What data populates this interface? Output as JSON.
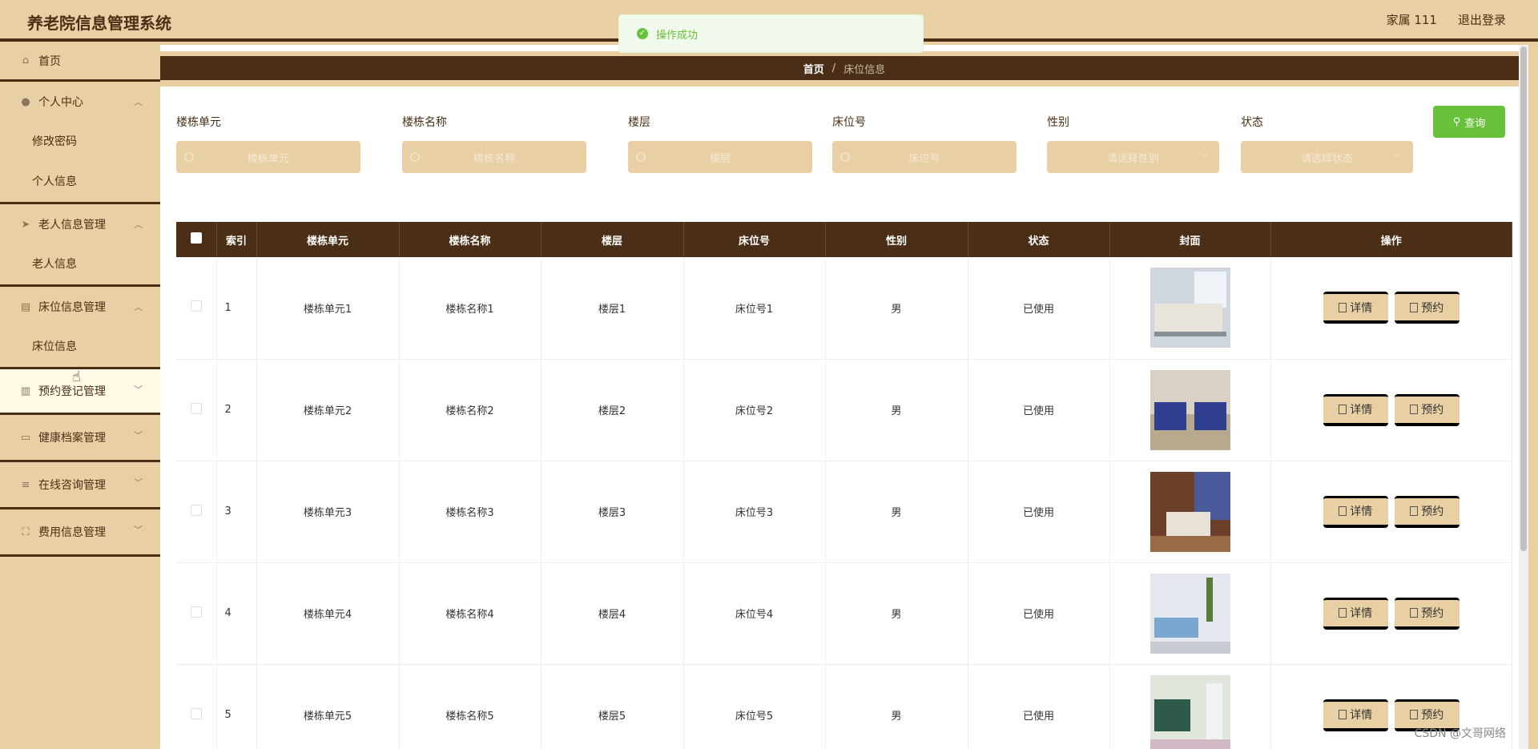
{
  "header": {
    "title": "养老院信息管理系统",
    "user": "家属 111",
    "logout": "退出登录"
  },
  "toast": {
    "message": "操作成功"
  },
  "sidebar": {
    "home": "首页",
    "personal": {
      "label": "个人中心",
      "items": [
        "修改密码",
        "个人信息"
      ]
    },
    "elder": {
      "label": "老人信息管理",
      "items": [
        "老人信息"
      ]
    },
    "bed": {
      "label": "床位信息管理",
      "items": [
        "床位信息"
      ]
    },
    "booking": "预约登记管理",
    "health": "健康档案管理",
    "consult": "在线咨询管理",
    "fee": "费用信息管理"
  },
  "breadcrumb": {
    "home": "首页",
    "sep": "/",
    "current": "床位信息"
  },
  "search": {
    "f1": {
      "label": "楼栋单元",
      "placeholder": "楼栋单元"
    },
    "f2": {
      "label": "楼栋名称",
      "placeholder": "楼栋名称"
    },
    "f3": {
      "label": "楼层",
      "placeholder": "楼层"
    },
    "f4": {
      "label": "床位号",
      "placeholder": "床位号"
    },
    "f5": {
      "label": "性别",
      "placeholder": "请选择性别"
    },
    "f6": {
      "label": "状态",
      "placeholder": "请选择状态"
    },
    "query": "查询"
  },
  "table": {
    "headers": [
      "索引",
      "楼栋单元",
      "楼栋名称",
      "楼层",
      "床位号",
      "性别",
      "状态",
      "封面",
      "操作"
    ],
    "detail": "详情",
    "book": "预约",
    "rows": [
      {
        "idx": "1",
        "unit": "楼栋单元1",
        "name": "楼栋名称1",
        "floor": "楼层1",
        "bed": "床位号1",
        "gender": "男",
        "status": "已使用"
      },
      {
        "idx": "2",
        "unit": "楼栋单元2",
        "name": "楼栋名称2",
        "floor": "楼层2",
        "bed": "床位号2",
        "gender": "男",
        "status": "已使用"
      },
      {
        "idx": "3",
        "unit": "楼栋单元3",
        "name": "楼栋名称3",
        "floor": "楼层3",
        "bed": "床位号3",
        "gender": "男",
        "status": "已使用"
      },
      {
        "idx": "4",
        "unit": "楼栋单元4",
        "name": "楼栋名称4",
        "floor": "楼层4",
        "bed": "床位号4",
        "gender": "男",
        "status": "已使用"
      },
      {
        "idx": "5",
        "unit": "楼栋单元5",
        "name": "楼栋名称5",
        "floor": "楼层5",
        "bed": "床位号5",
        "gender": "男",
        "status": "已使用"
      }
    ]
  },
  "watermark": "CSDN @文哥网络"
}
